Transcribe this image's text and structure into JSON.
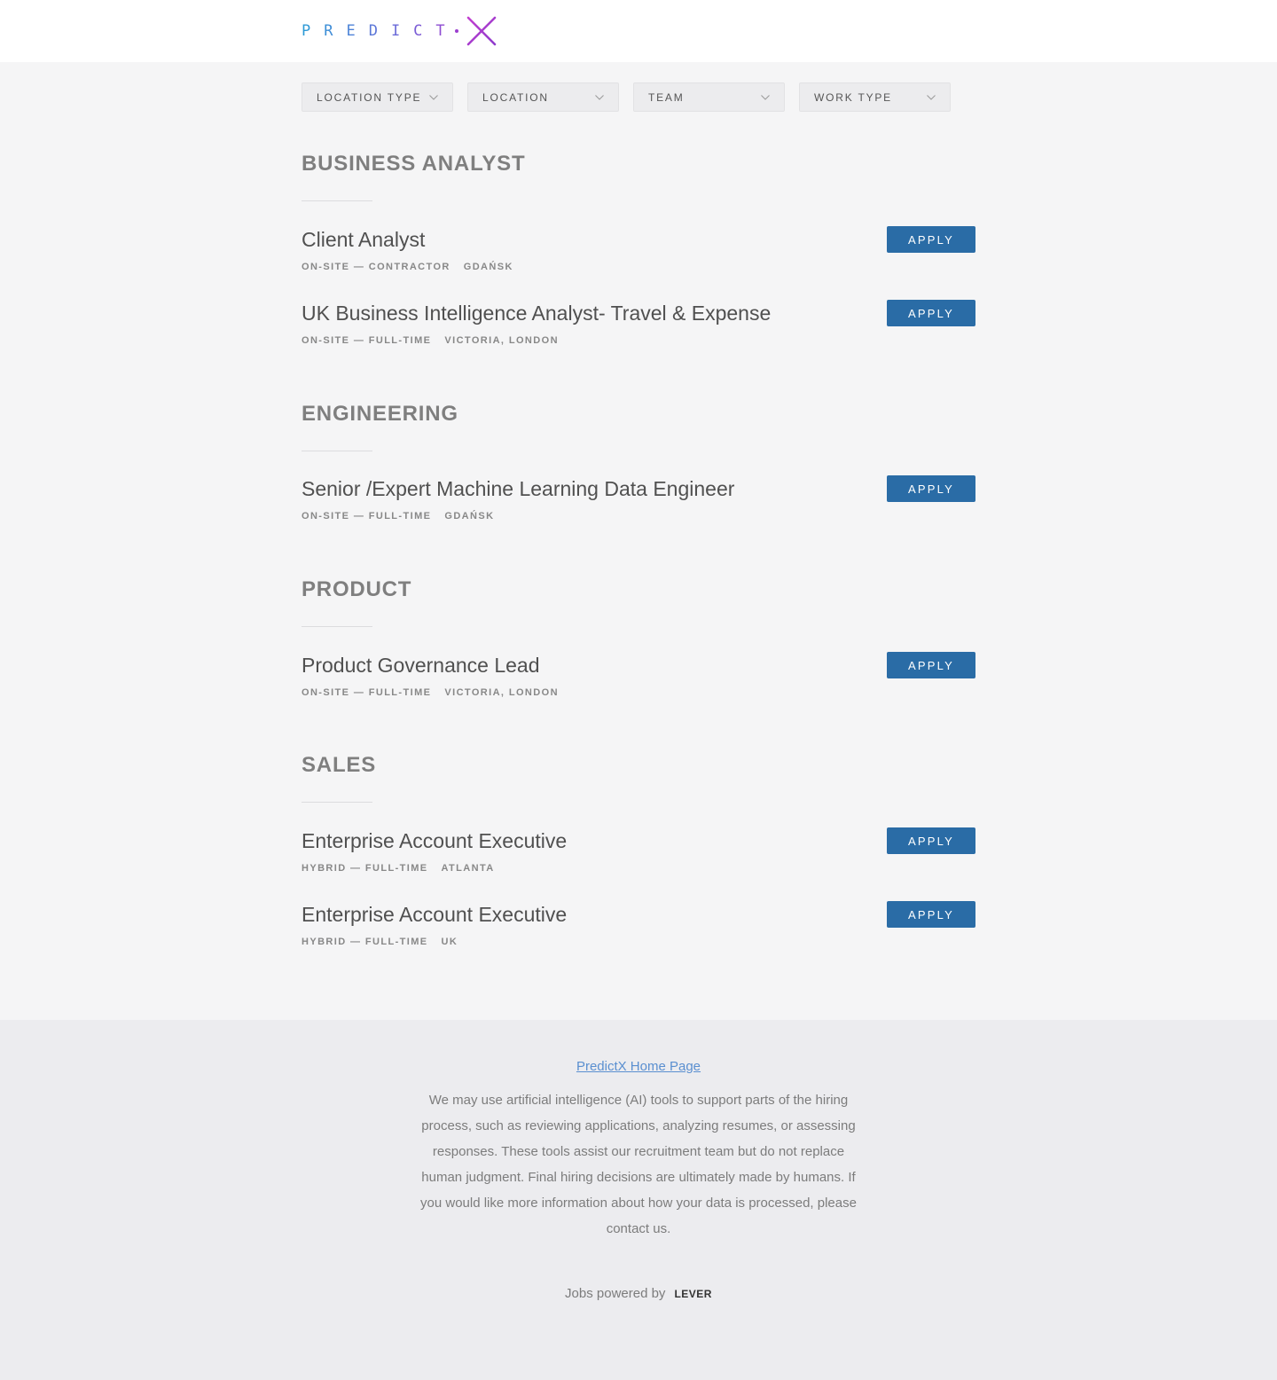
{
  "brand": {
    "logo_text": "PREDICT",
    "logo_mark": "X",
    "gradient_start": "#2a9bd6",
    "gradient_end": "#9b3fcf"
  },
  "filters": [
    {
      "label": "LOCATION TYPE",
      "icon": "chevron-down-icon"
    },
    {
      "label": "LOCATION",
      "icon": "chevron-down-icon"
    },
    {
      "label": "TEAM",
      "icon": "chevron-down-icon"
    },
    {
      "label": "WORK TYPE",
      "icon": "chevron-down-icon"
    }
  ],
  "groups": [
    {
      "title": "BUSINESS ANALYST",
      "postings": [
        {
          "title": "Client Analyst",
          "commitment": "ON-SITE — CONTRACTOR",
          "location": "GDAŃSK",
          "apply_label": "APPLY"
        },
        {
          "title": "UK Business Intelligence Analyst- Travel & Expense",
          "commitment": "ON-SITE — FULL-TIME",
          "location": "VICTORIA, LONDON",
          "apply_label": "APPLY"
        }
      ]
    },
    {
      "title": "ENGINEERING",
      "postings": [
        {
          "title": "Senior /Expert Machine Learning Data Engineer",
          "commitment": "ON-SITE — FULL-TIME",
          "location": "GDAŃSK",
          "apply_label": "APPLY"
        }
      ]
    },
    {
      "title": "PRODUCT",
      "postings": [
        {
          "title": "Product Governance Lead",
          "commitment": "ON-SITE — FULL-TIME",
          "location": "VICTORIA, LONDON",
          "apply_label": "APPLY"
        }
      ]
    },
    {
      "title": "SALES",
      "postings": [
        {
          "title": "Enterprise Account Executive",
          "commitment": "HYBRID — FULL-TIME",
          "location": "ATLANTA",
          "apply_label": "APPLY"
        },
        {
          "title": "Enterprise Account Executive",
          "commitment": "HYBRID — FULL-TIME",
          "location": "UK",
          "apply_label": "APPLY"
        }
      ]
    }
  ],
  "footer": {
    "home_link": "PredictX Home Page",
    "notice": "We may use artificial intelligence (AI) tools to support parts of the hiring process, such as reviewing applications, analyzing resumes, or assessing responses. These tools assist our recruitment team but do not replace human judgment. Final hiring decisions are ultimately made by humans. If you would like more information about how your data is processed, please contact us.",
    "powered_by": "Jobs powered by",
    "powered_brand": "LEVER"
  },
  "colors": {
    "apply_button": "#2a6ca6",
    "link": "#5a8fd0"
  }
}
